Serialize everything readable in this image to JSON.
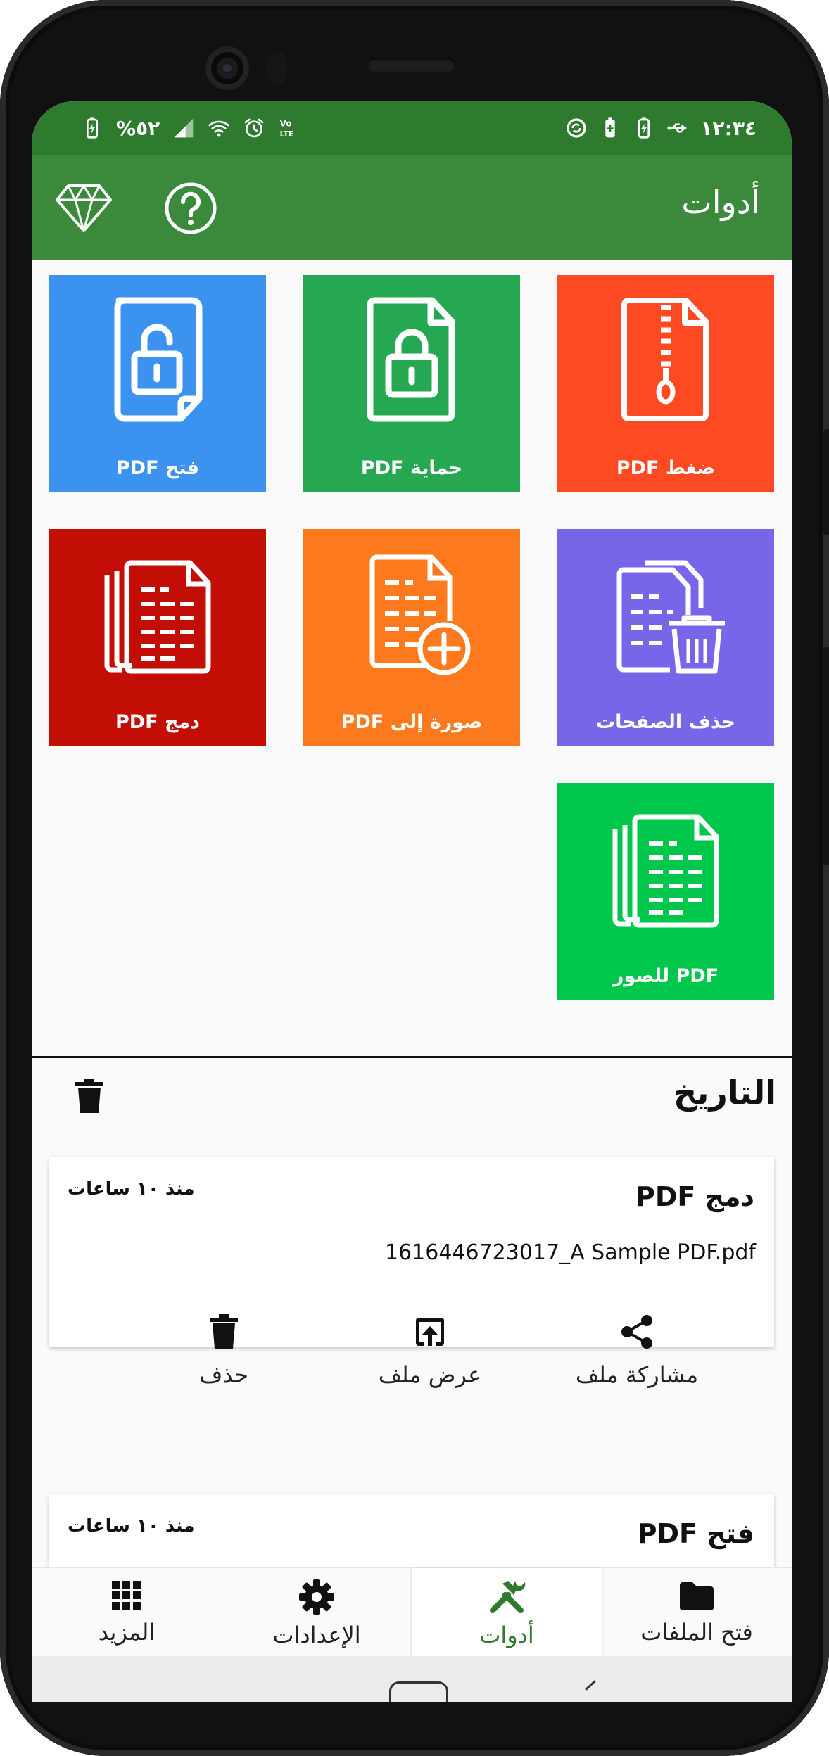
{
  "status_bar": {
    "battery": "%٥٢",
    "time": "١٢:٣٤"
  },
  "app_bar": {
    "title": "أدوات"
  },
  "tools": [
    {
      "label": "فتح PDF",
      "color": "#3c93ef",
      "icon": "unlock-file-icon"
    },
    {
      "label": "حماية PDF",
      "color": "#26a853",
      "icon": "lock-file-icon"
    },
    {
      "label": "ضغط PDF",
      "color": "#fd4a22",
      "icon": "zip-file-icon"
    },
    {
      "label": "دمج PDF",
      "color": "#c20e05",
      "icon": "merge-files-icon"
    },
    {
      "label": "صورة إلى PDF",
      "color": "#fc7a1d",
      "icon": "add-file-icon"
    },
    {
      "label": "حذف الصفحات",
      "color": "#7866e9",
      "icon": "delete-pages-icon"
    },
    {
      "label": "PDF للصور",
      "color": "#00c74b",
      "icon": "files-stack-icon"
    }
  ],
  "history": {
    "title": "التاريخ",
    "entries": [
      {
        "title": "دمج PDF",
        "time": "منذ ١٠ ساعات",
        "file": "1616446723017_A Sample PDF.pdf",
        "actions": {
          "share": "مشاركة ملف",
          "open": "عرض ملف",
          "delete": "حذف"
        }
      },
      {
        "title": "فتح PDF",
        "time": "منذ ١٠ ساعات"
      }
    ]
  },
  "bottom_nav": {
    "items": [
      {
        "label": "المزيد",
        "icon": "grid-icon"
      },
      {
        "label": "الإعدادات",
        "icon": "gear-icon"
      },
      {
        "label": "أدوات",
        "icon": "tools-icon",
        "active": true
      },
      {
        "label": "فتح الملفات",
        "icon": "folder-icon"
      }
    ]
  },
  "colors": {
    "status_bar": "#2e7a2e",
    "app_bar": "#3b8a3b",
    "accent": "#2e7a2e"
  }
}
